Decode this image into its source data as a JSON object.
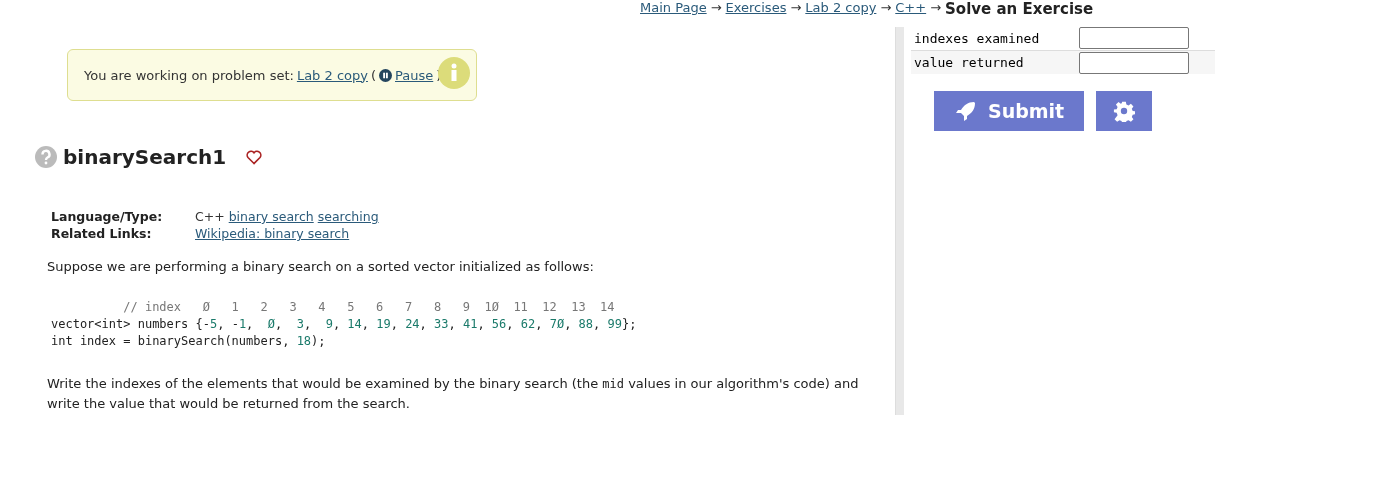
{
  "breadcrumb": {
    "links": [
      "Main Page",
      "Exercises",
      "Lab 2 copy",
      "C++"
    ],
    "separator": "→",
    "current": "Solve an Exercise"
  },
  "notice": {
    "text": "You are working on problem set:",
    "set_link": "Lab 2 copy",
    "open_paren": "(",
    "pause_link": "Pause",
    "close_paren": ")"
  },
  "problem": {
    "title": "binarySearch1",
    "favorite": false
  },
  "meta": [
    {
      "label": "Language/Type:",
      "prefix": "C++",
      "links": [
        "binary search",
        "searching"
      ]
    },
    {
      "label": "Related Links:",
      "links": [
        "Wikipedia: binary search"
      ]
    }
  ],
  "intro": "Suppose we are performing a binary search on a sorted vector initialized as follows:",
  "code": [
    {
      "kind": "comment",
      "text": "          // index   Ø   1   2   3   4   5   6   7   8   9  1Ø  11  12  13  14"
    },
    {
      "kind": "code",
      "text": "vector<int> numbers {-5, -1,  Ø,  3,  9, 14, 19, 24, 33, 41, 56, 62, 7Ø, 88, 99};"
    },
    {
      "kind": "code",
      "text": "int index = binarySearch(numbers, 18);"
    }
  ],
  "question": {
    "before": "Write the indexes of the elements that would be examined by the binary search (the ",
    "code": "mid",
    "after": " values in our algorithm's code) and write the value that would be returned from the search."
  },
  "answers": [
    {
      "label": "indexes examined"
    },
    {
      "label": "value returned"
    }
  ],
  "submit": "Submit"
}
